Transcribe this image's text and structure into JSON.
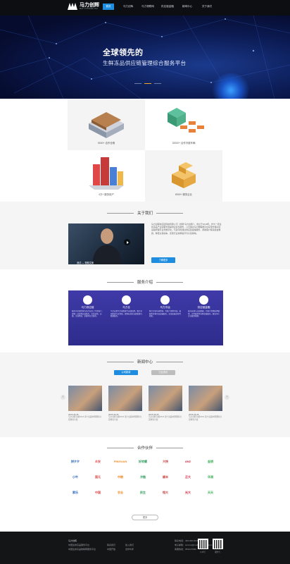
{
  "brand": {
    "name": "马力创辉",
    "sub": "MALI CHUANG HUI",
    "accent": "#1e8de0"
  },
  "nav": [
    "首页",
    "马力创辉",
    "马力物联网",
    "供应链金融",
    "新闻中心",
    "关于我们"
  ],
  "hero": {
    "title": "全球领先的",
    "subtitle": "生鲜冻品供应链管理综合服务平台"
  },
  "stats": [
    {
      "label": "5000+ 合作仓储"
    },
    {
      "label": "32000+ 合作冷链车辆"
    },
    {
      "label": "4万+ 服务用户"
    },
    {
      "label": "8000+ 服务企业"
    }
  ],
  "about": {
    "title": "关于我们",
    "video_caption": "测试 — 视频文案",
    "text": "马力创辉供应链科技有限公司（简称\"马力创辉\"），成立于2018年。作为一家生鲜冻品产业链服务商提供全链条服务，公司通过马力物联网平台实现仓储冷链运输管理与业务数字化。与此同时通过供应链金融服务，帮助客户解决资金难题，降低交易成本，实现行业效率提升与价值重构。",
    "button": "了解更多"
  },
  "services": {
    "title": "服务介绍",
    "items": [
      {
        "title": "马力供应链",
        "desc": "服务于全国生鲜冻品行业的上下游客户，提供一站式供应链服务，包括采购、仓储、冷链物流、金融等综合服务。"
      },
      {
        "title": "马力仓",
        "desc": "马力仓是马力创辉旗下仓储品牌，整合全国优质冷库资源，提供标准化仓储管理与数据服务。"
      },
      {
        "title": "马力冷运",
        "desc": "整合冷链车辆资源，为客户提供干线、城配等多种冷链运输服务，实现运输全程可视化。"
      },
      {
        "title": "供应链金融",
        "desc": "依托仓储与交易数据，为客户提供质押融资、订单融资等多种金融服务，解决中小企业融资难题。"
      }
    ]
  },
  "news": {
    "title": "新闻中心",
    "tabs": [
      "公司新闻",
      "行业资讯"
    ],
    "items": [
      {
        "date": "2018-05-28",
        "title": "马力创辉亮相2018 第十四届中国国际冷链物流大会"
      },
      {
        "date": "2018-05-28",
        "title": "马力创辉亮相2018 第十四届中国国际冷链物流大会"
      },
      {
        "date": "2018-05-28",
        "title": "马力创辉亮相2018 第十四届中国国际冷链物流大会"
      },
      {
        "date": "2018-05-28",
        "title": "马力创辉亮相2018 第十四届中国国际冷链物流大会"
      }
    ]
  },
  "partners": {
    "title": "合作伙伴",
    "logos": [
      "拼夕夕",
      "众安",
      "PINGUAN",
      "好欢螺",
      "大快",
      "ANZ",
      "金钥",
      "小牛",
      "国元",
      "中粮",
      "冷链",
      "顺丰",
      "正大",
      "华润",
      "家乐",
      "中国",
      "农业",
      "民生",
      "恒大",
      "光大",
      "天天"
    ],
    "more": "更多"
  },
  "footer": {
    "col1": [
      "马力创辉",
      "中国生鲜冻品服务平台",
      "中国生鲜冻品物联网服务平台"
    ],
    "col2": [
      "联系我们",
      "中国开放"
    ],
    "col3": [
      "加入我们",
      "合作伙伴"
    ],
    "col4": [
      "联系电话：400-096-6616",
      "电子邮箱：service@malichuanghui.com",
      "客服热线：0530-87060"
    ],
    "qr": [
      "公众号",
      "服务号"
    ]
  }
}
